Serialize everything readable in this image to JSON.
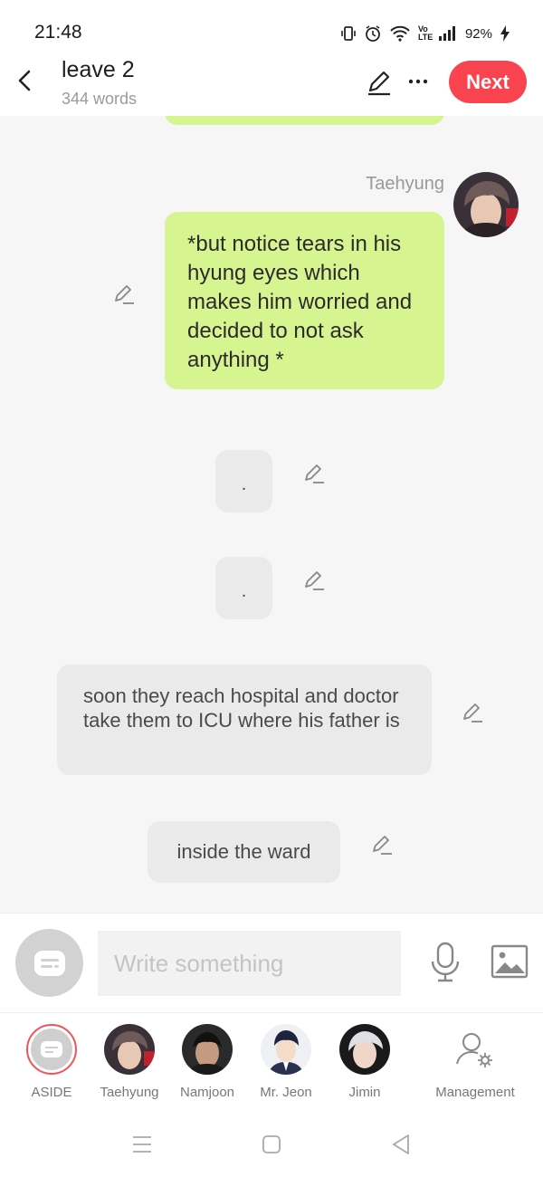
{
  "status_bar": {
    "time": "21:48",
    "lte": "Vo LTE",
    "battery": "92%"
  },
  "header": {
    "title": "leave 2",
    "subtitle": "344 words",
    "next_label": "Next"
  },
  "messages": {
    "sender": "Taehyung",
    "green_text": "*but notice tears in his hyung eyes which makes him worried and decided to not ask anything *",
    "dot1": ".",
    "dot2": ".",
    "narration": "soon they reach hospital and doctor take them to ICU where his father is",
    "ward": "inside the ward"
  },
  "composer": {
    "placeholder": "Write something"
  },
  "characters": [
    {
      "name": "ASIDE"
    },
    {
      "name": "Taehyung"
    },
    {
      "name": "Namjoon"
    },
    {
      "name": "Mr. Jeon"
    },
    {
      "name": "Jimin"
    },
    {
      "name": "Management"
    }
  ],
  "colors": {
    "accent": "#f9434f",
    "bubble_green": "#d6f591",
    "bubble_grey": "#eaeaea"
  },
  "icons": [
    "back-icon",
    "pencil-icon",
    "more-icon",
    "microphone-icon",
    "image-icon",
    "user-settings-icon",
    "menu-icon",
    "home-square-icon",
    "back-triangle-icon"
  ]
}
